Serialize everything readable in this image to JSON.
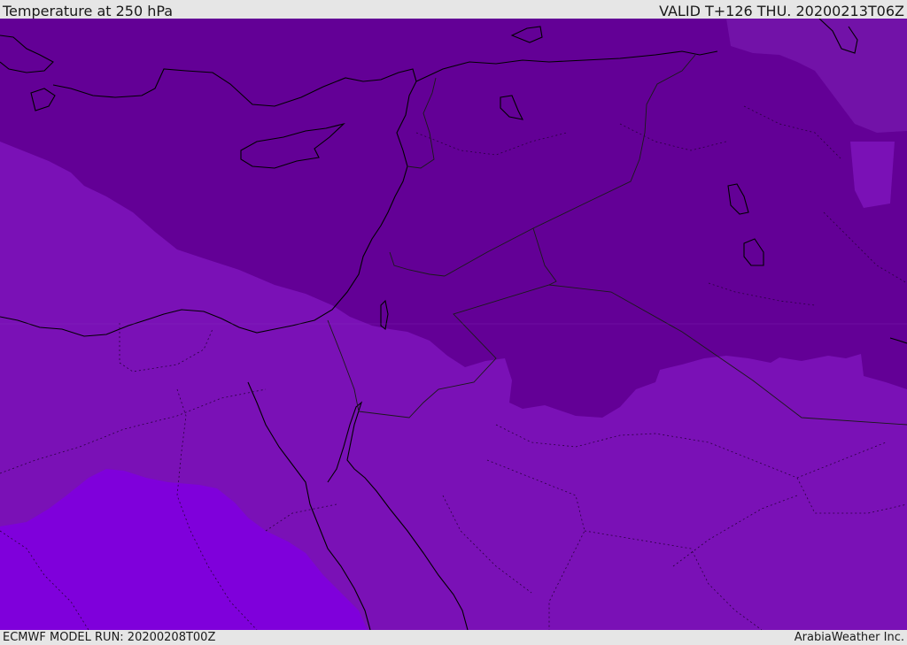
{
  "header": {
    "title": "Temperature at 250 hPa",
    "valid_time": "VALID T+126 THU. 20200213T06Z"
  },
  "footer": {
    "model_run": "ECMWF MODEL RUN: 20200208T00Z",
    "credit": "ArabiaWeather Inc."
  },
  "map": {
    "field": "temperature",
    "level": "250 hPa",
    "colors": {
      "coldest": "#630096",
      "cold": "#7813b0",
      "mild": "#7a11b6",
      "warm": "#7f00db",
      "coastline": "#000000",
      "border": "#1a1a1a"
    }
  }
}
